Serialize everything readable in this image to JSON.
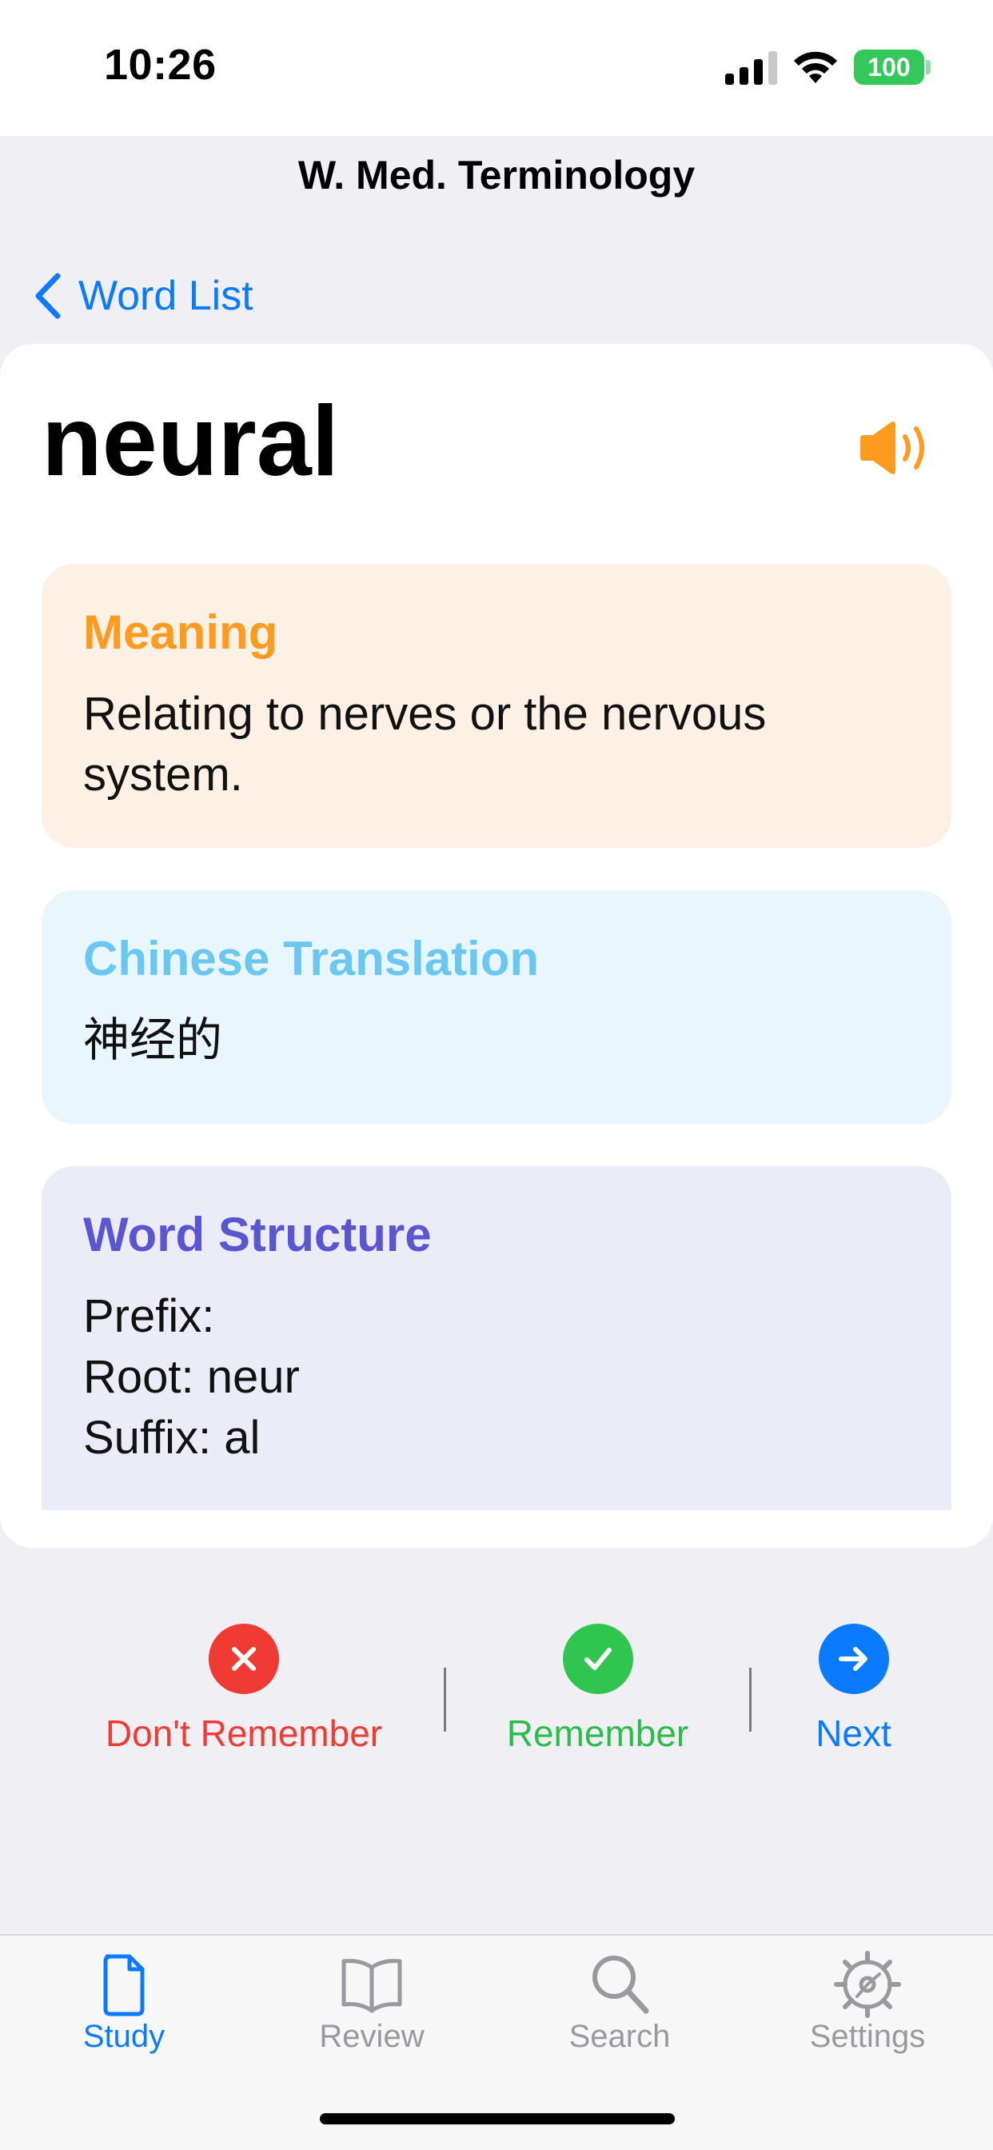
{
  "status_bar": {
    "time": "10:26",
    "battery": "100"
  },
  "nav": {
    "title": "W. Med. Terminology",
    "back_label": "Word List"
  },
  "word": {
    "term": "neural",
    "meaning_heading": "Meaning",
    "meaning": "Relating to nerves or the nervous system.",
    "chinese_heading": "Chinese Translation",
    "chinese": "神经的",
    "structure_heading": "Word Structure",
    "structure": {
      "prefix": "Prefix: ",
      "root": "Root: neur",
      "suffix": "Suffix: al"
    }
  },
  "actions": {
    "dont_remember": "Don't Remember",
    "remember": "Remember",
    "next": "Next"
  },
  "tabs": [
    {
      "label": "Study",
      "icon": "document-icon",
      "selected": true
    },
    {
      "label": "Review",
      "icon": "book-icon",
      "selected": false
    },
    {
      "label": "Search",
      "icon": "magnifier-icon",
      "selected": false
    },
    {
      "label": "Settings",
      "icon": "gear-icon",
      "selected": false
    }
  ],
  "colors": {
    "accent": "#0a7aff",
    "meaning": "#ff9b1f",
    "chinese": "#6ac7f2",
    "structure": "#5a56d1",
    "danger": "#f03b34",
    "success": "#2fc54f"
  }
}
